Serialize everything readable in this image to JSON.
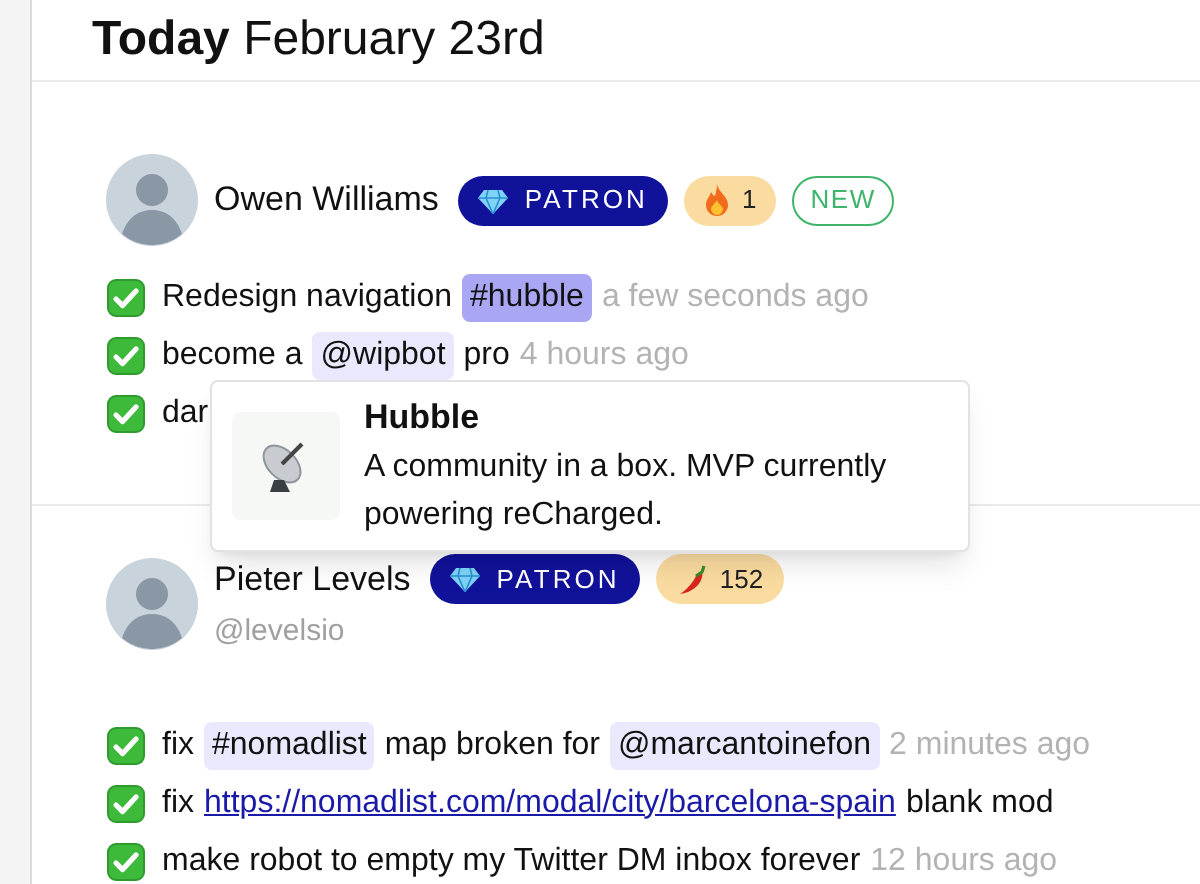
{
  "header": {
    "bold": "Today",
    "date": "February 23rd"
  },
  "posts": [
    {
      "name": "Owen Williams",
      "badges": [
        {
          "kind": "patron",
          "label": "PATRON"
        },
        {
          "kind": "fire",
          "label": "1"
        },
        {
          "kind": "new",
          "label": "NEW"
        }
      ],
      "items": [
        {
          "done": true,
          "parts": [
            {
              "kind": "text",
              "text": "Redesign navigation"
            },
            {
              "kind": "tag",
              "text": "#hubble",
              "selected": true
            },
            {
              "kind": "time",
              "text": "a few seconds ago"
            }
          ]
        },
        {
          "done": true,
          "parts": [
            {
              "kind": "text",
              "text": "become a"
            },
            {
              "kind": "tag",
              "text": "@wipbot",
              "selected": false
            },
            {
              "kind": "text",
              "text": "pro"
            },
            {
              "kind": "time",
              "text": "4 hours ago"
            }
          ]
        },
        {
          "done": true,
          "parts": [
            {
              "kind": "text",
              "text": "dar"
            }
          ]
        }
      ],
      "tooltip": {
        "title": "Hubble",
        "description": "A community in a box. MVP currently powering reCharged."
      }
    },
    {
      "name": "Pieter Levels",
      "handle": "@levelsio",
      "badges": [
        {
          "kind": "patron",
          "label": "PATRON"
        },
        {
          "kind": "pepper",
          "label": "152"
        }
      ],
      "items": [
        {
          "done": true,
          "parts": [
            {
              "kind": "text",
              "text": "fix"
            },
            {
              "kind": "tag",
              "text": "#nomadlist",
              "selected": false
            },
            {
              "kind": "text",
              "text": "map broken for"
            },
            {
              "kind": "tag",
              "text": "@marcantoinefon",
              "selected": false
            },
            {
              "kind": "time",
              "text": "2 minutes ago"
            }
          ]
        },
        {
          "done": true,
          "parts": [
            {
              "kind": "text",
              "text": "fix"
            },
            {
              "kind": "link",
              "text": "https://nomadlist.com/modal/city/barcelona-spain"
            },
            {
              "kind": "text",
              "text": "blank mod"
            }
          ]
        },
        {
          "done": true,
          "parts": [
            {
              "kind": "text",
              "text": "make robot to empty my Twitter DM inbox forever"
            },
            {
              "kind": "time",
              "text": "12 hours ago"
            }
          ]
        }
      ]
    }
  ]
}
